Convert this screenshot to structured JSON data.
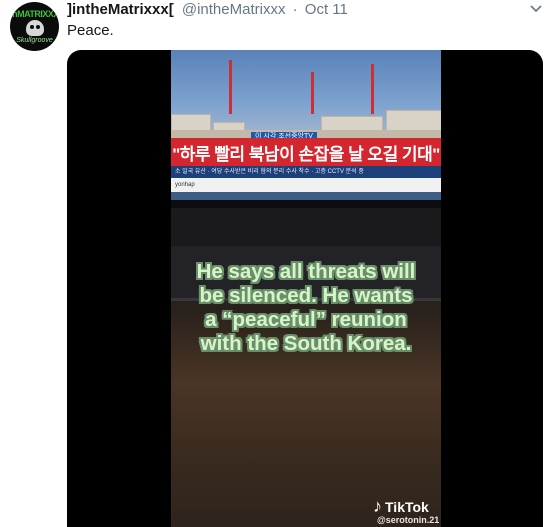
{
  "tweet": {
    "display_name": "]intheMatrixxx[",
    "handle": "@intheMatrixxx",
    "separator": "·",
    "time": "Oct 11",
    "text": "Peace."
  },
  "avatar": {
    "line1": "inMATRIXXX",
    "line2": "Skullgroove"
  },
  "icons": {
    "more": "chevron-down-icon",
    "tiktok": "tiktok-logo-icon"
  },
  "video": {
    "tv_banner_top": "이 시각 조선중앙TV",
    "tv_banner": "\"하루 빨리 북남이 손잡을 날 오길 기대\"",
    "tv_ticker": "소 일국 유산 · 여당 수사받은 비리 혐의 분리 수사 착수 · 고층 CCTV 분석 중",
    "tv_logo": "yonhap",
    "caption": "He says all threats will be silenced. He wants a “peaceful” reunion with the South Korea.",
    "tiktok_label": "TikTok",
    "tiktok_user": "@serotonin.21"
  },
  "colors": {
    "name": "#14171a",
    "meta": "#657786",
    "caption_fill": "#d6f5c8",
    "caption_outline": "#6a8f6a",
    "banner_red": "#d4262f"
  }
}
